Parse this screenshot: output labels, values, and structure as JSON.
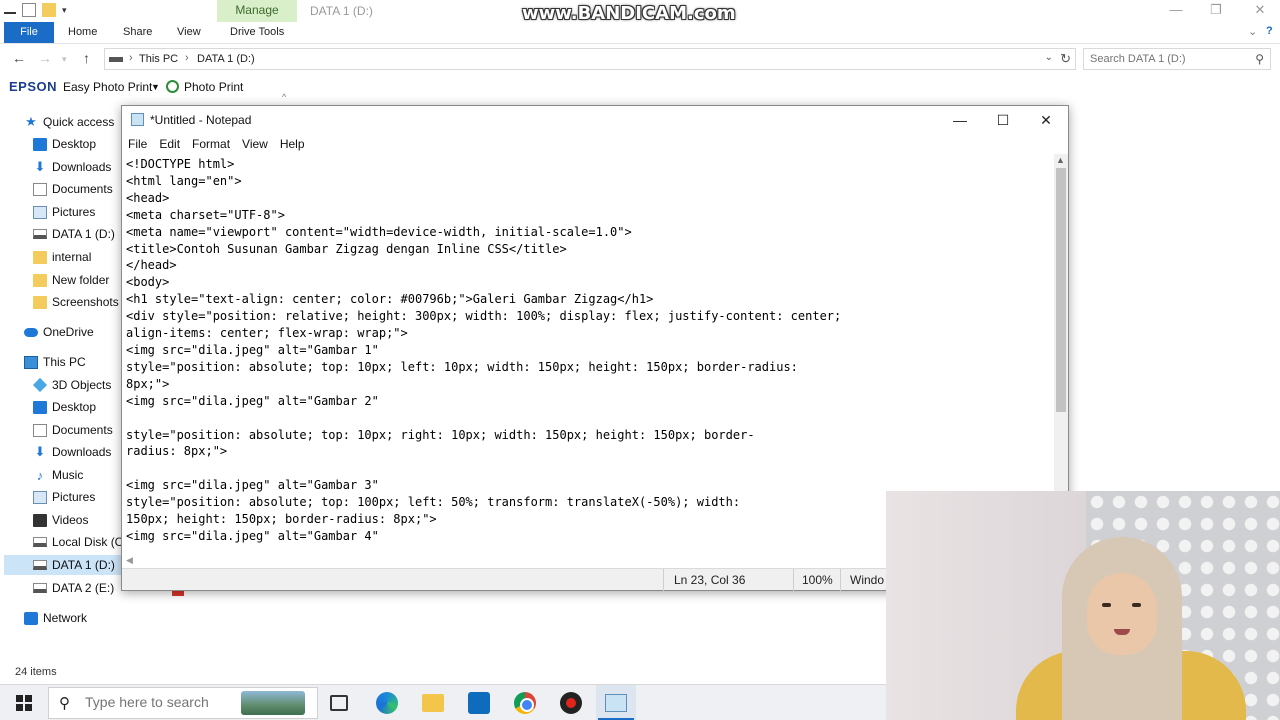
{
  "explorer": {
    "manage_tab": "Manage",
    "window_title": "DATA 1 (D:)",
    "tabs": {
      "file": "File",
      "home": "Home",
      "share": "Share",
      "view": "View",
      "drive_tools": "Drive Tools"
    },
    "breadcrumb": [
      "This PC",
      "DATA 1 (D:)"
    ],
    "search_placeholder": "Search DATA 1 (D:)",
    "epson": {
      "logo": "EPSON",
      "easy_photo_print": "Easy Photo Print",
      "photo_print": "Photo Print"
    },
    "nav": {
      "quick_access": "Quick access",
      "quick_items": [
        "Desktop",
        "Downloads",
        "Documents",
        "Pictures",
        "DATA 1 (D:)",
        "internal",
        "New folder",
        "Screenshots"
      ],
      "onedrive": "OneDrive",
      "this_pc": "This PC",
      "pc_items": [
        "3D Objects",
        "Desktop",
        "Documents",
        "Downloads",
        "Music",
        "Pictures",
        "Videos",
        "Local Disk (C:)",
        "DATA 1 (D:)",
        "DATA 2 (E:)"
      ],
      "network": "Network"
    },
    "item_count": "24 items"
  },
  "watermark": "www.BANDICAM.com",
  "notepad": {
    "title": "*Untitled - Notepad",
    "menu": [
      "File",
      "Edit",
      "Format",
      "View",
      "Help"
    ],
    "content": "<!DOCTYPE html>\n<html lang=\"en\">\n<head>\n<meta charset=\"UTF-8\">\n<meta name=\"viewport\" content=\"width=device-width, initial-scale=1.0\">\n<title>Contoh Susunan Gambar Zigzag dengan Inline CSS</title>\n</head>\n<body>\n<h1 style=\"text-align: center; color: #00796b;\">Galeri Gambar Zigzag</h1>\n<div style=\"position: relative; height: 300px; width: 100%; display: flex; justify-content: center;\nalign-items: center; flex-wrap: wrap;\">\n<img src=\"dila.jpeg\" alt=\"Gambar 1\"\nstyle=\"position: absolute; top: 10px; left: 10px; width: 150px; height: 150px; border-radius:\n8px;\">\n<img src=\"dila.jpeg\" alt=\"Gambar 2\"\n\nstyle=\"position: absolute; top: 10px; right: 10px; width: 150px; height: 150px; border-\nradius: 8px;\">\n\n<img src=\"dila.jpeg\" alt=\"Gambar 3\"\nstyle=\"position: absolute; top: 100px; left: 50%; transform: translateX(-50%); width:\n150px; height: 150px; border-radius: 8px;\">\n<img src=\"dila.jpeg\" alt=\"Gambar 4\"",
    "status": {
      "position": "Ln 23, Col 36",
      "zoom": "100%",
      "line_ending": "Windo"
    }
  },
  "taskbar": {
    "search_placeholder": "Type here to search"
  },
  "icons": {
    "quick_access": "star-icon",
    "downloads": "download-arrow-icon",
    "music": "music-note-icon",
    "search": "magnifier-icon"
  }
}
